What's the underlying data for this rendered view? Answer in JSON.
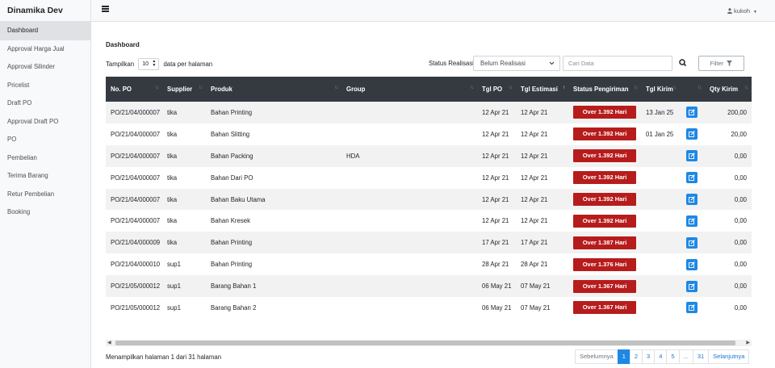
{
  "app": {
    "brand": "Dinamika Dev"
  },
  "sidebar": {
    "items": [
      {
        "label": "Dashboard",
        "active": true
      },
      {
        "label": "Approval Harga Jual"
      },
      {
        "label": "Approval Silinder"
      },
      {
        "label": "Pricelist"
      },
      {
        "label": "Draft PO"
      },
      {
        "label": "Approval Draft PO"
      },
      {
        "label": "PO"
      },
      {
        "label": "Pembelian"
      },
      {
        "label": "Terima Barang"
      },
      {
        "label": "Retur Pembelian"
      },
      {
        "label": "Booking"
      }
    ]
  },
  "topbar": {
    "user": "kukoh",
    "menu_icon": "hamburger-icon",
    "user_icon": "person-icon"
  },
  "page": {
    "title": "Dashboard"
  },
  "controls": {
    "show_label": "Tampilkan",
    "page_size": "10",
    "per_page_label": "data per halaman",
    "status_label": "Status Realisasi",
    "status_value": "Belum Realisasi",
    "search_placeholder": "Cari Data",
    "filter_label": "Filter"
  },
  "table": {
    "columns": [
      "No. PO",
      "Supplier",
      "Produk",
      "Group",
      "Tgl PO",
      "Tgl Estimasi",
      "Status Pengiriman",
      "Tgl Kirim",
      "",
      "Qty Kirim"
    ],
    "rows": [
      {
        "no_po": "PO/21/04/000007",
        "supplier": "tika",
        "produk": "Bahan Printing",
        "group": "",
        "tgl_po": "12 Apr 21",
        "tgl_est": "12 Apr 21",
        "status": "Over 1.392 Hari",
        "tgl_kirim": "13 Jan 25",
        "qty": "200,00"
      },
      {
        "no_po": "PO/21/04/000007",
        "supplier": "tika",
        "produk": "Bahan Slitting",
        "group": "",
        "tgl_po": "12 Apr 21",
        "tgl_est": "12 Apr 21",
        "status": "Over 1.392 Hari",
        "tgl_kirim": "01 Jan 25",
        "qty": "20,00"
      },
      {
        "no_po": "PO/21/04/000007",
        "supplier": "tika",
        "produk": "Bahan Packing",
        "group": "HDA",
        "tgl_po": "12 Apr 21",
        "tgl_est": "12 Apr 21",
        "status": "Over 1.392 Hari",
        "tgl_kirim": "",
        "qty": "0,00"
      },
      {
        "no_po": "PO/21/04/000007",
        "supplier": "tika",
        "produk": "Bahan Dari PO",
        "group": "",
        "tgl_po": "12 Apr 21",
        "tgl_est": "12 Apr 21",
        "status": "Over 1.392 Hari",
        "tgl_kirim": "",
        "qty": "0,00"
      },
      {
        "no_po": "PO/21/04/000007",
        "supplier": "tika",
        "produk": "Bahan Baku Utama",
        "group": "",
        "tgl_po": "12 Apr 21",
        "tgl_est": "12 Apr 21",
        "status": "Over 1.392 Hari",
        "tgl_kirim": "",
        "qty": "0,00"
      },
      {
        "no_po": "PO/21/04/000007",
        "supplier": "tika",
        "produk": "Bahan Kresek",
        "group": "",
        "tgl_po": "12 Apr 21",
        "tgl_est": "12 Apr 21",
        "status": "Over 1.392 Hari",
        "tgl_kirim": "",
        "qty": "0,00"
      },
      {
        "no_po": "PO/21/04/000009",
        "supplier": "tika",
        "produk": "Bahan Printing",
        "group": "",
        "tgl_po": "17 Apr 21",
        "tgl_est": "17 Apr 21",
        "status": "Over 1.387 Hari",
        "tgl_kirim": "",
        "qty": "0,00"
      },
      {
        "no_po": "PO/21/04/000010",
        "supplier": "sup1",
        "produk": "Bahan Printing",
        "group": "",
        "tgl_po": "28 Apr 21",
        "tgl_est": "28 Apr 21",
        "status": "Over 1.376 Hari",
        "tgl_kirim": "",
        "qty": "0,00"
      },
      {
        "no_po": "PO/21/05/000012",
        "supplier": "sup1",
        "produk": "Barang Bahan 1",
        "group": "",
        "tgl_po": "06 May 21",
        "tgl_est": "07 May 21",
        "status": "Over 1.367 Hari",
        "tgl_kirim": "",
        "qty": "0,00"
      },
      {
        "no_po": "PO/21/05/000012",
        "supplier": "sup1",
        "produk": "Barang Bahan 2",
        "group": "",
        "tgl_po": "06 May 21",
        "tgl_est": "07 May 21",
        "status": "Over 1.367 Hari",
        "tgl_kirim": "",
        "qty": "0,00"
      }
    ]
  },
  "footer": {
    "info": "Menampilkan halaman 1 dari 31 halaman",
    "pagination": [
      "Sebelumnya",
      "1",
      "2",
      "3",
      "4",
      "5",
      "...",
      "31",
      "Selanjutnya"
    ],
    "active_page": "1"
  },
  "colors": {
    "header_bg": "#343a40",
    "badge_red": "#b71c1c",
    "accent_blue": "#1e88e5"
  }
}
